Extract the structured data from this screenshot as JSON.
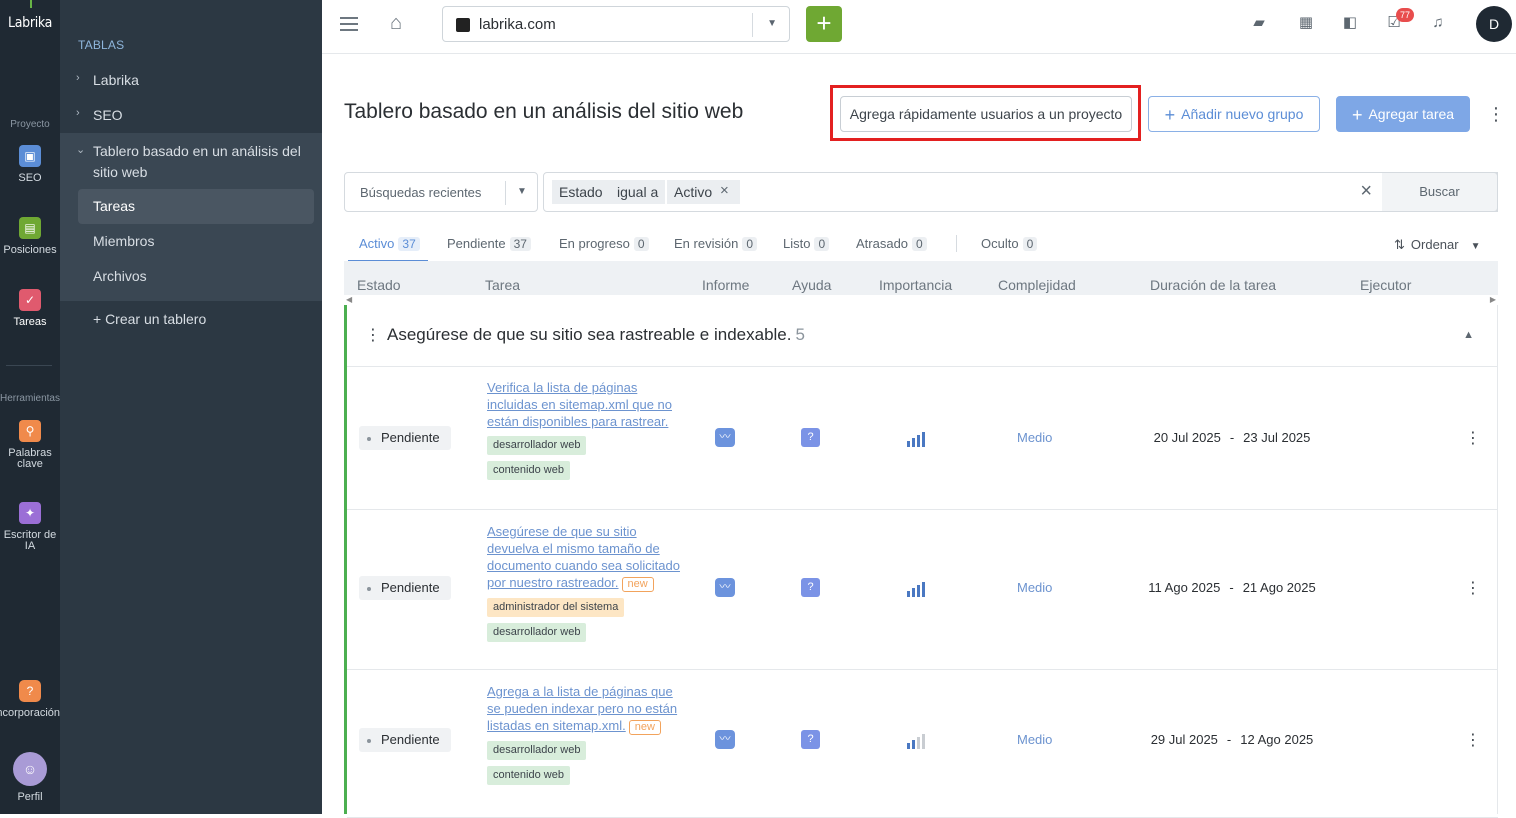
{
  "rail": {
    "logo": "Labrika",
    "section_project": "Proyecto",
    "section_tools": "Herramientas",
    "items": {
      "seo": "SEO",
      "positions": "Posiciones",
      "tasks": "Tareas",
      "keywords": "Palabras clave",
      "ai_writer": "Escritor de IA",
      "onboarding": "Incorporación",
      "profile": "Perfil"
    }
  },
  "sidebar": {
    "title": "TABLAS",
    "items": [
      "Labrika",
      "SEO",
      "Tablero basado en un análisis del sitio web"
    ],
    "subitems": [
      "Tareas",
      "Miembros",
      "Archivos"
    ],
    "create": "+ Crear un tablero"
  },
  "topbar": {
    "site": "labrika.com",
    "notifications_badge": "77",
    "user_initial": "D"
  },
  "header": {
    "title": "Tablero basado en un análisis del sitio web",
    "quick_add": "Agrega rápidamente usuarios a un proyecto",
    "add_group": "Añadir nuevo grupo",
    "add_task": "Agregar tarea"
  },
  "filters": {
    "recent_searches": "Búsquedas recientes",
    "chip_field": "Estado",
    "chip_op": "igual a",
    "chip_value": "Activo",
    "search": "Buscar"
  },
  "tabs": [
    {
      "label": "Activo",
      "count": "37"
    },
    {
      "label": "Pendiente",
      "count": "37"
    },
    {
      "label": "En progreso",
      "count": "0"
    },
    {
      "label": "En revisión",
      "count": "0"
    },
    {
      "label": "Listo",
      "count": "0"
    },
    {
      "label": "Atrasado",
      "count": "0"
    },
    {
      "label": "Oculto",
      "count": "0"
    }
  ],
  "sort_label": "Ordenar",
  "columns": [
    "Estado",
    "Tarea",
    "Informe",
    "Ayuda",
    "Importancia",
    "Complejidad",
    "Duración de la tarea",
    "Ejecutor"
  ],
  "group": {
    "title": "Asegúrese de que su sitio sea rastreable e indexable.",
    "count": "5"
  },
  "rows": [
    {
      "status": "Pendiente",
      "task": "Verifica la lista de páginas incluidas en sitemap.xml que no están disponibles para rastrear.",
      "is_new": false,
      "tags": [
        "desarrollador web",
        "contenido web"
      ],
      "importance_level": 4,
      "complexity": "Medio",
      "start": "20 Jul 2025",
      "end": "23 Jul 2025"
    },
    {
      "status": "Pendiente",
      "task": "Asegúrese de que su sitio devuelva el mismo tamaño de documento cuando sea solicitado por nuestro rastreador.",
      "is_new": true,
      "tags": [
        "administrador del sistema",
        "desarrollador web"
      ],
      "importance_level": 4,
      "complexity": "Medio",
      "start": "11 Ago 2025",
      "end": "21 Ago 2025"
    },
    {
      "status": "Pendiente",
      "task": "Agrega a la lista de páginas que se pueden indexar pero no están listadas en sitemap.xml.",
      "is_new": true,
      "tags": [
        "desarrollador web",
        "contenido web"
      ],
      "importance_level": 2,
      "complexity": "Medio",
      "start": "29 Jul 2025",
      "end": "12 Ago 2025"
    }
  ],
  "new_label": "new",
  "date_separator": "-",
  "colors": {
    "accent": "#5b8dd6",
    "green": "#6fa833",
    "highlight_box": "#e32020",
    "group_border": "#4caf50"
  }
}
